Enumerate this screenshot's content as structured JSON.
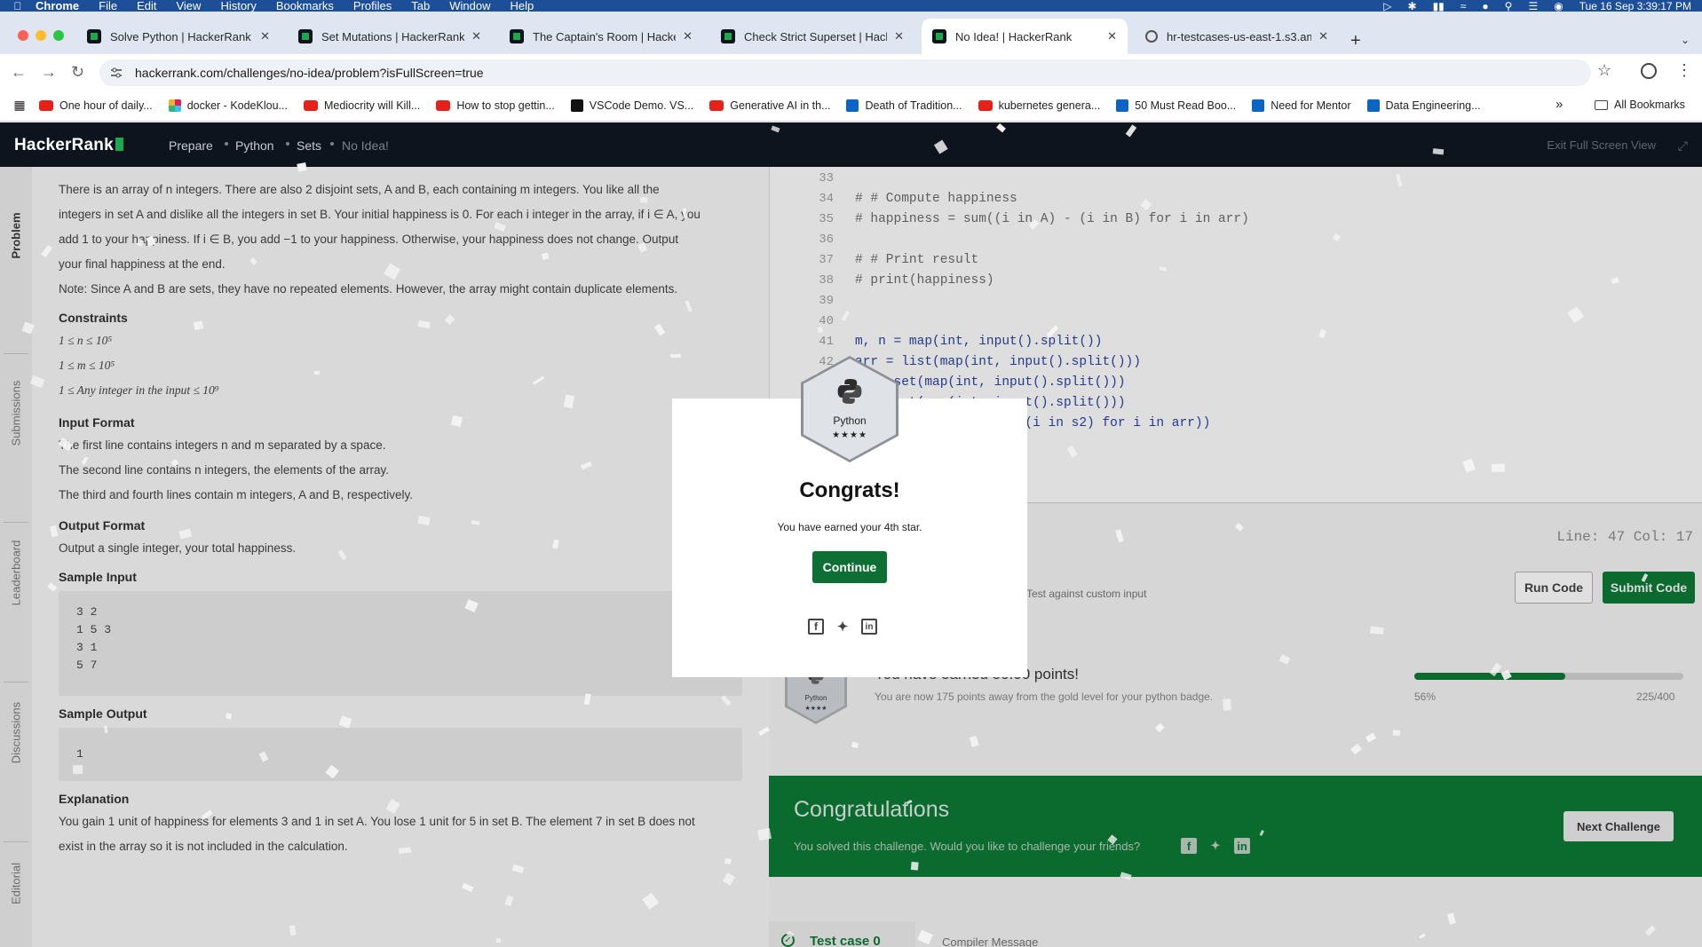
{
  "menubar": {
    "app": "Chrome",
    "items": [
      "File",
      "Edit",
      "View",
      "History",
      "Bookmarks",
      "Profiles",
      "Tab",
      "Window",
      "Help"
    ],
    "clock": "Tue 16 Sep  3:39:17 PM"
  },
  "tabs": [
    {
      "title": "Solve Python | HackerRank"
    },
    {
      "title": "Set Mutations | HackerRank"
    },
    {
      "title": "The Captain's Room | HackerR"
    },
    {
      "title": "Check Strict Superset | Hacke"
    },
    {
      "title": "No Idea! | HackerRank"
    },
    {
      "title": "hr-testcases-us-east-1.s3.am"
    }
  ],
  "address": {
    "url": "hackerrank.com/challenges/no-idea/problem?isFullScreen=true"
  },
  "bookmarks": {
    "items": [
      {
        "label": "One hour of daily...",
        "icon": "youtube"
      },
      {
        "label": "docker - KodeKlou...",
        "icon": "slack"
      },
      {
        "label": "Mediocrity will Kill...",
        "icon": "youtube"
      },
      {
        "label": "How to stop gettin...",
        "icon": "youtube"
      },
      {
        "label": "VSCode Demo. VS...",
        "icon": "vscode"
      },
      {
        "label": "Generative AI in th...",
        "icon": "youtube"
      },
      {
        "label": "Death of Tradition...",
        "icon": "linkedin"
      },
      {
        "label": "kubernetes genera...",
        "icon": "youtube"
      },
      {
        "label": "50 Must Read Boo...",
        "icon": "linkedin"
      },
      {
        "label": "Need for Mentor",
        "icon": "linkedin"
      },
      {
        "label": "Data Engineering...",
        "icon": "linkedin"
      }
    ],
    "more": "»",
    "all": "All Bookmarks"
  },
  "hr": {
    "logo": "HackerRank",
    "crumbs": [
      "Prepare",
      "Python",
      "Sets",
      "No Idea!"
    ],
    "exit": "Exit Full Screen View",
    "side_tabs": [
      "Problem",
      "Submissions",
      "Leaderboard",
      "Discussions",
      "Editorial"
    ]
  },
  "problem": {
    "intro_1": "There is an array of n integers. There are also 2 disjoint sets, A and B, each containing m integers. You like all the",
    "intro_2": "integers in set A and dislike all the integers in set B. Your initial happiness is 0. For each i integer in the array, if i ∈ A, you",
    "intro_3": "add 1 to your happiness. If i ∈ B, you add −1 to your happiness. Otherwise, your happiness does not change. Output",
    "intro_4": "your final happiness at the end.",
    "note": "Note: Since A and B are sets, they have no repeated elements. However, the array might contain duplicate elements.",
    "constraints_h": "Constraints",
    "constraints": [
      "1 ≤ n ≤ 10⁵",
      "1 ≤ m ≤ 10⁵",
      "1 ≤ Any integer in the input ≤ 10⁹"
    ],
    "input_h": "Input Format",
    "input_lines": [
      "The first line contains integers n and m separated by a space.",
      "The second line contains n integers, the elements of the array.",
      "The third and fourth lines contain m integers, A and B, respectively."
    ],
    "output_h": "Output Format",
    "output_line": "Output a single integer, your total happiness.",
    "sample_in_h": "Sample Input",
    "sample_in": "3 2\n1 5 3\n3 1\n5 7",
    "sample_out_h": "Sample Output",
    "sample_out": "1",
    "explain_h": "Explanation",
    "explain_1": "You gain 1 unit of happiness for elements 3 and 1 in set A. You lose 1 unit for 5 in set B. The element 7 in set B does not",
    "explain_2": "exist in the array so it is not included in the calculation."
  },
  "editor": {
    "lines": [
      {
        "n": "33",
        "t": ""
      },
      {
        "n": "34",
        "t": "# # Compute happiness"
      },
      {
        "n": "35",
        "t": "# happiness = sum((i in A) - (i in B) for i in arr)"
      },
      {
        "n": "36",
        "t": ""
      },
      {
        "n": "37",
        "t": "# # Print result"
      },
      {
        "n": "38",
        "t": "# print(happiness)"
      },
      {
        "n": "39",
        "t": ""
      },
      {
        "n": "40",
        "t": ""
      },
      {
        "n": "41",
        "t": "m, n = map(int, input().split())"
      },
      {
        "n": "42",
        "t": "arr = list(map(int, input().split()))"
      },
      {
        "n": "43",
        "t": "s1 = set(map(int, input().split()))"
      },
      {
        "n": "44",
        "t": "s2 = set(map(int, input().split()))"
      },
      {
        "n": "45",
        "t": "print(sum((i in s1) - (i in s2) for i in arr))"
      }
    ],
    "status": "Line: 47  Col: 17",
    "custom_input": "Test against custom input",
    "run": "Run Code",
    "submit": "Submit Code"
  },
  "points": {
    "title": "You have earned 50.00 points!",
    "sub": "You are now 175 points away from the gold level for your python badge.",
    "pct_label": "56%",
    "progress": 0.5625,
    "score": "225/400",
    "badge_label": "Python",
    "badge_stars": "★★★★"
  },
  "banner": {
    "title": "Congratulations",
    "sub": "You solved this challenge. Would you like to challenge your friends?",
    "next": "Next Challenge"
  },
  "testcase": {
    "label": "Test case 0",
    "compiler": "Compiler Message"
  },
  "modal": {
    "badge_label": "Python",
    "badge_stars": "★★★★",
    "title": "Congrats!",
    "sub": "You have earned your 4th star.",
    "continue": "Continue"
  },
  "colors": {
    "hr_green": "#1ba94c",
    "dark_green": "#0b6b2f",
    "nav": "#0e141e"
  }
}
